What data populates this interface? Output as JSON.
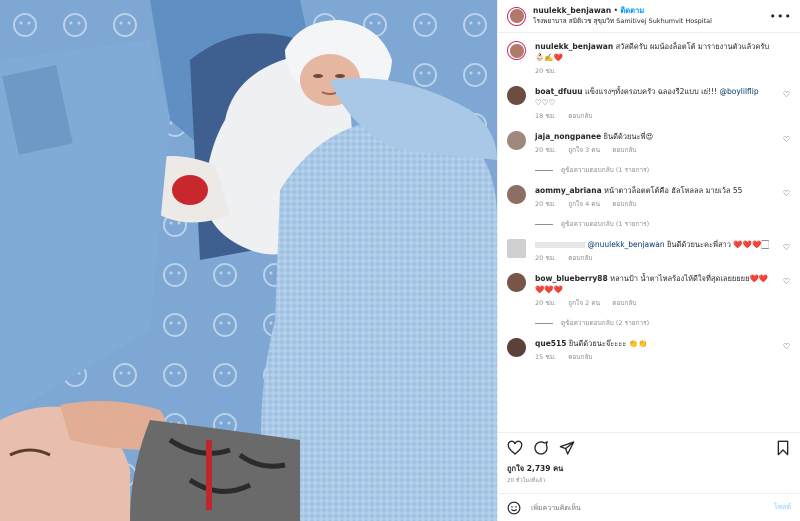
{
  "header": {
    "username": "nuulekk_benjawan",
    "separator": "•",
    "follow_label": "ติดตาม",
    "location": "โรงพยาบาล สมิติเวช สุขุมวิท Samitivej Sukhumvit Hospital",
    "more_icon": "more-icon"
  },
  "caption": {
    "username": "nuulekk_benjawan",
    "text": "สวัสดีครับ ผมน้องล็อตโต้ มารายงานตัวแล้วครับ",
    "emojis": "👶🏻✍️❤️",
    "time": "20 ชม."
  },
  "comments": [
    {
      "username": "boat_dfuuu",
      "text": "แข็งแรงๆทั้งครอบครัว ฉลองรี2แบบ เย่!!! ",
      "mention": "@boylilflip",
      "hearts": "♡♡♡",
      "time": "18 ชม.",
      "likes": "",
      "reply": "ตอบกลับ",
      "color": "#6d4c41"
    },
    {
      "username": "jaja_nongpanee",
      "text": "ยินดีด้วยนะพี่😍",
      "time": "20 ชม.",
      "likes": "ถูกใจ 3 คน",
      "reply": "ตอบกลับ",
      "view_replies": "ดูข้อความตอบกลับ (1 รายการ)",
      "color": "#a1887f"
    },
    {
      "username": "aommy_abriana",
      "text": "หน้าตาวล็อตตโต้คือ ฮัลโหลลล มายเว้ล 55",
      "time": "20 ชม.",
      "likes": "ถูกใจ 4 คน",
      "reply": "ตอบกลับ",
      "view_replies": "ดูข้อความตอบกลับ (1 รายการ)",
      "color": "#8d6e63"
    },
    {
      "username": "",
      "mention": "@nuulekk_benjawan",
      "text": " ยินดีด้วยนะคะพี่สาว ❤️❤️❤️🏻",
      "time": "20 ชม.",
      "likes": "",
      "reply": "ตอบกลับ",
      "color": "#d0d0d0"
    },
    {
      "username": "bow_blueberry88",
      "text": "หลานป้า น้ำตาไหลร้องไห้ดีใจที่สุดเลยยยยย❤️❤️❤️❤️❤️",
      "time": "20 ชม.",
      "likes": "ถูกใจ 2 คน",
      "reply": "ตอบกลับ",
      "view_replies": "ดูข้อความตอบกลับ (2 รายการ)",
      "color": "#795548"
    },
    {
      "username": "que515",
      "text": "ยินดีด้วยนะจ๊ะะะะ 👏👏",
      "time": "15 ชม.",
      "likes": "",
      "reply": "ตอบกลับ",
      "color": "#5d4037"
    }
  ],
  "actions": {
    "like_icon": "heart-icon",
    "comment_icon": "comment-icon",
    "share_icon": "share-icon",
    "save_icon": "bookmark-icon",
    "likes_text": "ถูกใจ 2,739 คน",
    "posted": "20 ชั่วโมงที่แล้ว"
  },
  "add_comment": {
    "placeholder": "เพิ่มความคิดเห็น",
    "post_label": "โพสต์"
  },
  "colors": {
    "accent": "#0095f6",
    "drape": "#8db3d8",
    "blanket": "#eef0f2"
  }
}
